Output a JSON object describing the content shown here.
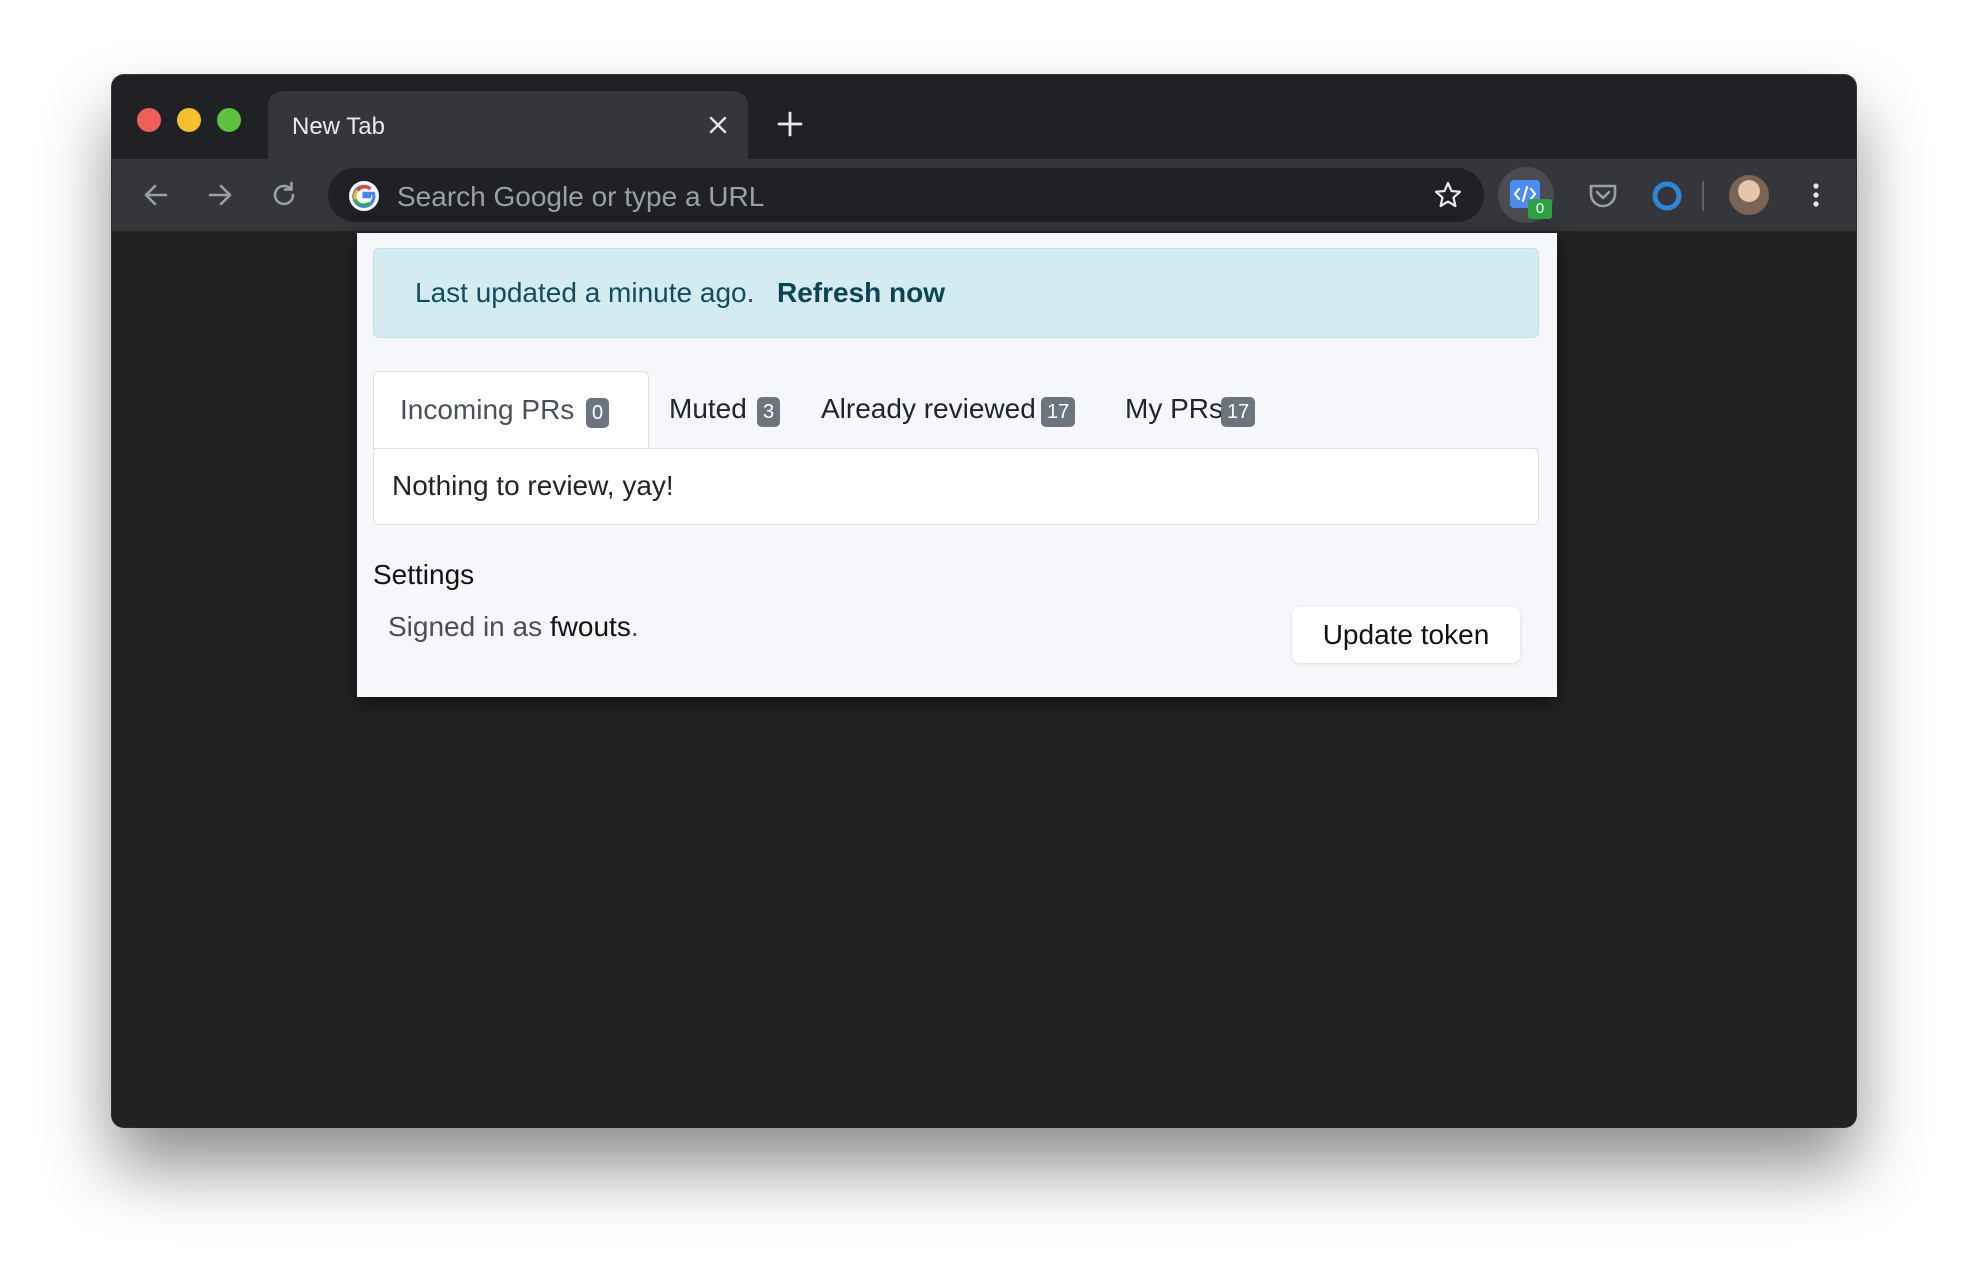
{
  "browser": {
    "tab_title": "New Tab",
    "omnibox_placeholder": "Search Google or type a URL",
    "extension_badge": "0"
  },
  "popup": {
    "status_text": "Last updated a minute ago.",
    "refresh_link": "Refresh now",
    "tabs": [
      {
        "label": "Incoming PRs",
        "count": "0"
      },
      {
        "label": "Muted",
        "count": "3"
      },
      {
        "label": "Already reviewed",
        "count": "17"
      },
      {
        "label": "My PRs",
        "count": "17"
      }
    ],
    "panel_text": "Nothing to review, yay!",
    "settings_title": "Settings",
    "signed_in_prefix": "Signed in as",
    "username": "fwouts",
    "signed_in_suffix": ".",
    "update_button": "Update token"
  },
  "colors": {
    "alert_background": "#d4ebf1",
    "badge": "#6c757d",
    "extension_icon": "#4c8bf5",
    "extension_badge": "#2da043"
  }
}
